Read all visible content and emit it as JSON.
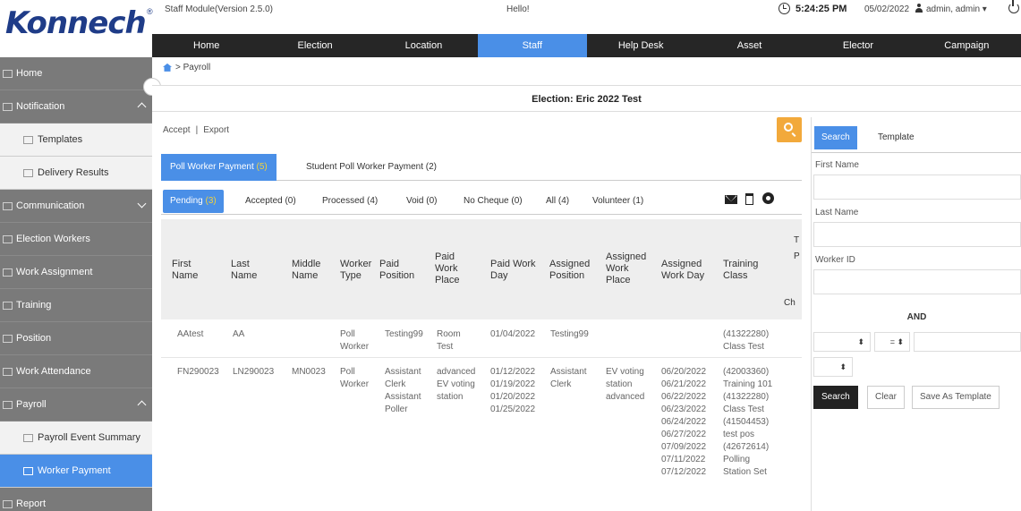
{
  "header": {
    "logo": "Konnech",
    "logo_mark": "®",
    "module_version": "Staff Module(Version 2.5.0)",
    "greeting": "Hello!",
    "time": "5:24:25 PM",
    "date": "05/02/2022",
    "user": "admin, admin ▾"
  },
  "nav": {
    "items": [
      "Home",
      "Election",
      "Location",
      "Staff",
      "Help Desk",
      "Asset",
      "Elector",
      "Campaign"
    ],
    "active_index": 3
  },
  "sidebar": {
    "items": [
      {
        "label": "Home"
      },
      {
        "label": "Notification"
      },
      {
        "label": "Templates"
      },
      {
        "label": "Delivery Results"
      },
      {
        "label": "Communication"
      },
      {
        "label": "Election Workers"
      },
      {
        "label": "Work Assignment"
      },
      {
        "label": "Training"
      },
      {
        "label": "Position"
      },
      {
        "label": "Work Attendance"
      },
      {
        "label": "Payroll"
      },
      {
        "label": "Payroll Event Summary"
      },
      {
        "label": "Worker Payment"
      },
      {
        "label": "Report"
      }
    ]
  },
  "breadcrumb": "> Payroll",
  "election_title": "Election: Eric 2022 Test",
  "actions": {
    "accept": "Accept",
    "sep": "|",
    "export": "Export"
  },
  "outer_tabs": [
    {
      "label": "Poll Worker Payment",
      "count": "(5)"
    },
    {
      "label": "Student Poll Worker Payment (2)",
      "count": ""
    }
  ],
  "inner_tabs": [
    {
      "label": "Pending",
      "count": "(3)"
    },
    {
      "label": "Accepted (0)",
      "count": ""
    },
    {
      "label": "Processed (4)",
      "count": ""
    },
    {
      "label": "Void (0)",
      "count": ""
    },
    {
      "label": "No Cheque (0)",
      "count": ""
    },
    {
      "label": "All (4)",
      "count": ""
    },
    {
      "label": "Volunteer (1)",
      "count": ""
    }
  ],
  "table": {
    "headers": {
      "first_name": "First Name",
      "last_name": "Last Name",
      "middle_name": "Middle Name",
      "worker_type": "Worker Type",
      "paid_position": "Paid Position",
      "paid_work_place": "Paid Work Place",
      "paid_work_day": "Paid Work Day",
      "assigned_position": "Assigned Position",
      "assigned_work_place": "Assigned Work Place",
      "assigned_work_day": "Assigned Work Day",
      "training_class": "Training Class",
      "partial_t": "T",
      "partial_p": "P",
      "partial_ch": "Ch"
    },
    "rows": [
      {
        "first_name": "AAtest",
        "last_name": "AA",
        "middle_name": "",
        "worker_type": "Poll Worker",
        "paid_position": "Testing99",
        "paid_work_place": "Room Test",
        "paid_work_day": "01/04/2022",
        "assigned_position": "Testing99",
        "assigned_work_place": "",
        "assigned_work_day": "",
        "training_class": "(41322280) Class Test"
      },
      {
        "first_name": "FN290023",
        "last_name": "LN290023",
        "middle_name": "MN0023",
        "worker_type": "Poll Worker",
        "paid_position": "Assistant Clerk Assistant Poller",
        "paid_work_place": "advanced EV voting station",
        "paid_work_day": "01/12/2022 01/19/2022 01/20/2022 01/25/2022",
        "assigned_position": "Assistant Clerk",
        "assigned_work_place": "EV voting station advanced",
        "assigned_work_day": "06/20/2022 06/21/2022 06/22/2022 06/23/2022 06/24/2022 06/27/2022 07/09/2022 07/11/2022 07/12/2022",
        "training_class": "(42003360) Training 101 (41322280) Class Test (41504453) test pos (42672614) Polling Station Set"
      }
    ]
  },
  "right_panel": {
    "tabs": [
      "Search",
      "Template"
    ],
    "first_name_label": "First Name",
    "last_name_label": "Last Name",
    "worker_id_label": "Worker ID",
    "and_label": "AND",
    "sel1": "⬍",
    "sel2": "= ⬍",
    "sel3": "⬍",
    "search_btn": "Search",
    "clear_btn": "Clear",
    "save_template_btn": "Save As Template"
  }
}
